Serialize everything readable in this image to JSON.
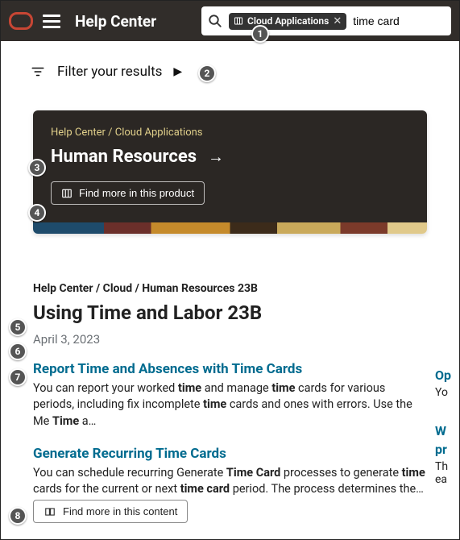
{
  "header": {
    "title": "Help Center",
    "search_chip": "Cloud Applications",
    "search_value": "time card"
  },
  "filter": {
    "label": "Filter your results"
  },
  "card": {
    "breadcrumb": "Help Center / Cloud Applications",
    "title": "Human Resources",
    "find_more_label": "Find more in this product"
  },
  "result": {
    "breadcrumb": "Help Center / Cloud / Human Resources 23B",
    "title": "Using Time and Labor 23B",
    "date": "April 3, 2023",
    "hits": [
      {
        "title": "Report Time and Absences with Time Cards",
        "body_html": "You can report your worked <b>time</b> and manage <b>time</b> cards for various periods, including fix incomplete <b>time</b> cards and ones with errors. Use the Me <b>Time</b> a…"
      },
      {
        "title": "Generate Recurring Time Cards",
        "body_html": "You can schedule recurring Generate <b>Time Card</b> processes to generate <b>time</b> cards for the current or next <b>time card</b> period. The process determines the…"
      }
    ],
    "side": [
      {
        "title": "Op",
        "body": "Yo"
      },
      {
        "title": "W",
        "title2": "pr",
        "body": "Th",
        "body2": "ea"
      }
    ],
    "find_more_content_label": "Find more in this content"
  },
  "callouts": [
    "1",
    "2",
    "3",
    "4",
    "5",
    "6",
    "7",
    "8"
  ]
}
